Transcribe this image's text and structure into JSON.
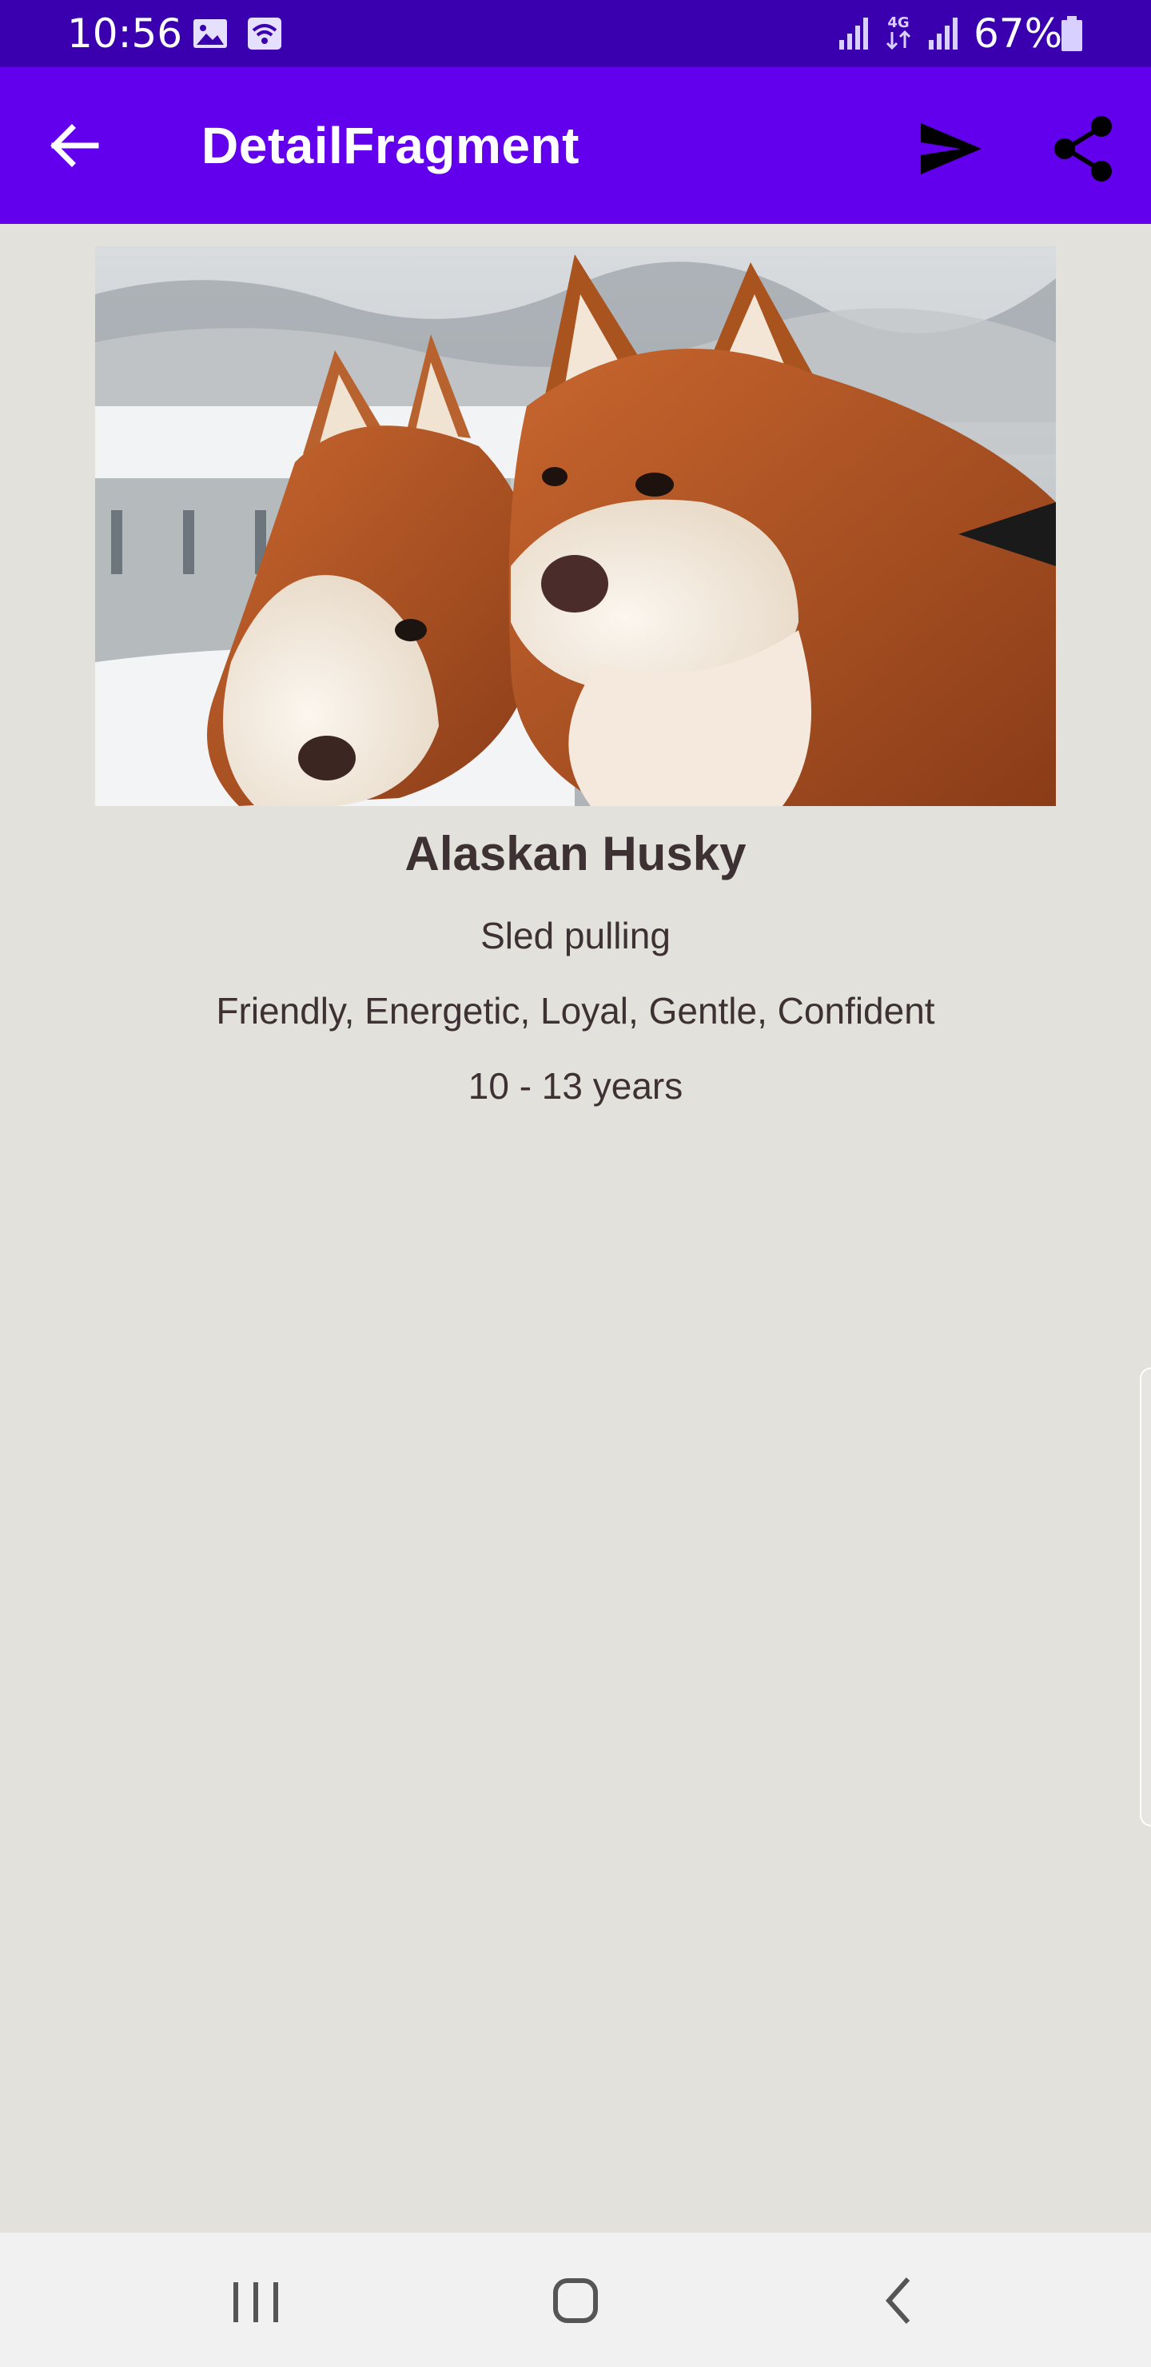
{
  "status_bar": {
    "time": "10:56",
    "battery": "67%",
    "icons": [
      "gallery-icon",
      "wifi-calling-icon",
      "signal-icon",
      "4g-data-icon",
      "signal-icon",
      "battery-icon"
    ]
  },
  "app_bar": {
    "title": "DetailFragment",
    "back_icon": "arrow-back-icon",
    "send_icon": "send-icon",
    "share_icon": "share-icon",
    "background_color": "#6200ee"
  },
  "dog": {
    "image_alt": "Two Alaskan Huskies in the snow",
    "name": "Alaskan Husky",
    "bred_for": "Sled pulling",
    "temperament": "Friendly, Energetic, Loyal, Gentle, Confident",
    "life_span": "10 - 13 years"
  },
  "nav_bar": {
    "icons": [
      "recent-apps-icon",
      "home-icon",
      "back-icon"
    ]
  },
  "colors": {
    "status_bar": "#3a00b0",
    "app_bar": "#6200ee",
    "background": "#e2e1dc",
    "text": "#3d3134"
  }
}
